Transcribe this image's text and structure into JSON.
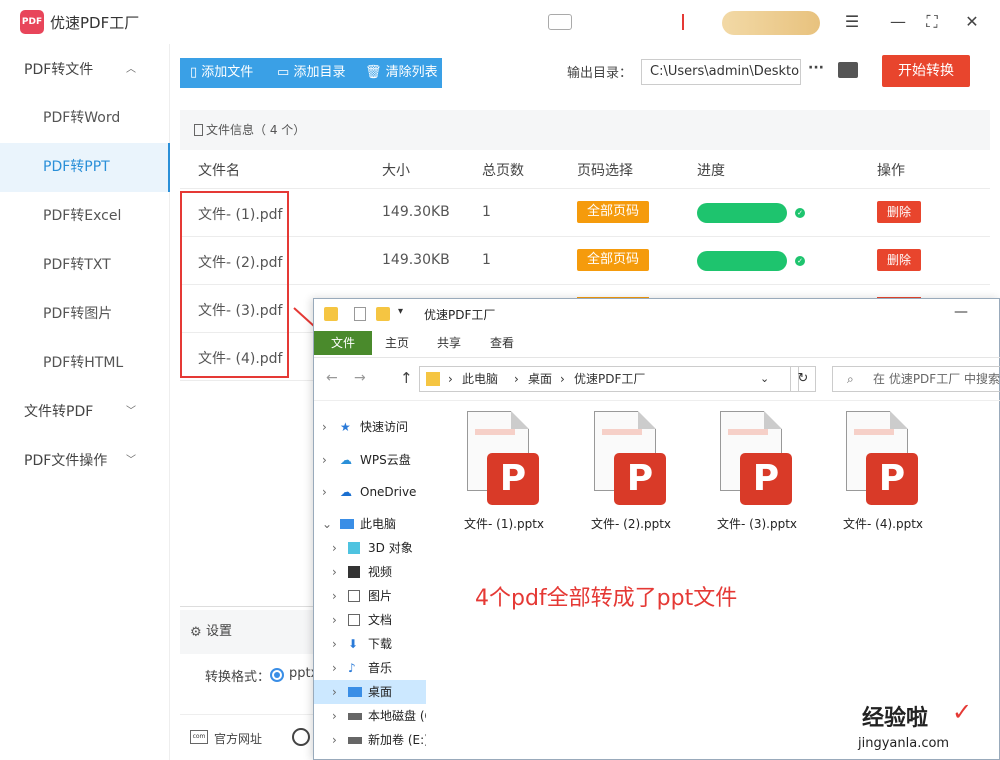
{
  "app": {
    "title": "优速PDF工厂",
    "logo_text": "PDF"
  },
  "sidebar": {
    "cat1": "PDF转文件",
    "items": [
      "PDF转Word",
      "PDF转PPT",
      "PDF转Excel",
      "PDF转TXT",
      "PDF转图片",
      "PDF转HTML"
    ],
    "cat2": "文件转PDF",
    "cat3": "PDF文件操作"
  },
  "toolbar": {
    "add_file": "添加文件",
    "add_dir": "添加目录",
    "clear_list": "清除列表",
    "output_label": "输出目录：",
    "output_path": "C:\\Users\\admin\\Desktop",
    "more": "···",
    "start": "开始转换"
  },
  "file_panel": {
    "header": "文件信息（ 4 个）",
    "columns": [
      "文件名",
      "大小",
      "总页数",
      "页码选择",
      "进度",
      "操作"
    ],
    "rows": [
      {
        "name": "文件- (1).pdf",
        "size": "149.30KB",
        "pages": "1",
        "page_sel": "全部页码",
        "progress": 1.0,
        "action": "删除"
      },
      {
        "name": "文件- (2).pdf",
        "size": "149.30KB",
        "pages": "1",
        "page_sel": "全部页码",
        "progress": 1.0,
        "action": "删除"
      },
      {
        "name": "文件- (3).pdf"
      },
      {
        "name": "文件- (4).pdf"
      }
    ]
  },
  "settings": {
    "title": "设置",
    "format_label": "转换格式：",
    "format_value": "pptx",
    "footer_link": "官方网址"
  },
  "explorer": {
    "title": "优速PDF工厂",
    "tabs": [
      "文件",
      "主页",
      "共享",
      "查看"
    ],
    "breadcrumb": [
      "此电脑",
      "桌面",
      "优速PDF工厂"
    ],
    "search_placeholder": "在 优速PDF工厂 中搜索",
    "tree": [
      "快速访问",
      "WPS云盘",
      "OneDrive",
      "此电脑",
      "3D 对象",
      "视频",
      "图片",
      "文档",
      "下载",
      "音乐",
      "桌面",
      "本地磁盘 (C",
      "新加卷 (E:)"
    ],
    "files": [
      "文件- (1).pptx",
      "文件- (2).pptx",
      "文件- (3).pptx",
      "文件- (4).pptx"
    ]
  },
  "annotation": "4个pdf全部转成了ppt文件",
  "watermark": {
    "text": "经验啦",
    "url": "jingyanla.com"
  },
  "colors": {
    "accent": "#3aa0e6",
    "start": "#e8452d",
    "badge": "#f59b0c",
    "progress": "#1ec46e",
    "annotation": "#e53935"
  }
}
